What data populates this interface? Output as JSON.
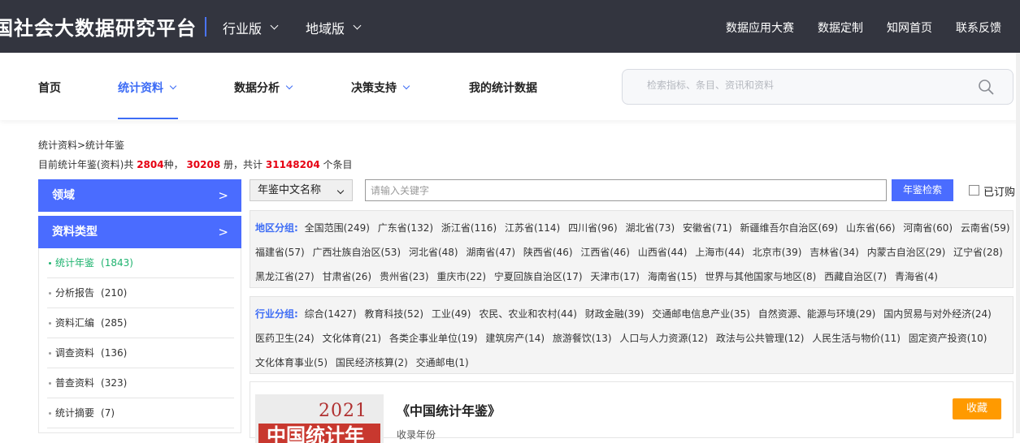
{
  "header": {
    "brand": "国社会大数据研究平台",
    "nav": [
      {
        "label": "行业版"
      },
      {
        "label": "地域版"
      }
    ],
    "links": [
      "数据应用大赛",
      "数据定制",
      "知网首页",
      "联系反馈"
    ]
  },
  "mainnav": {
    "items": [
      "首页",
      "统计资料",
      "数据分析",
      "决策支持",
      "我的统计数据"
    ],
    "active": "统计资料",
    "search_placeholder": "检索指标、条目、资讯和资料"
  },
  "breadcrumb": "统计资料>统计年鉴",
  "stats": {
    "prefix": "目前统计年鉴(资料)共",
    "kinds": "2804",
    "kinds_unit": "种，",
    "volumes": "30208",
    "volumes_unit": "册，共计",
    "entries": "31148204",
    "entries_unit": "个条目"
  },
  "sidebar": {
    "heads": [
      {
        "label": "领域",
        "arrow": ">"
      },
      {
        "label": "资料类型",
        "arrow": ">"
      }
    ],
    "items": [
      {
        "label": "统计年鉴",
        "count": "(1843)"
      },
      {
        "label": "分析报告",
        "count": "(210)"
      },
      {
        "label": "资料汇编",
        "count": "(285)"
      },
      {
        "label": "调查资料",
        "count": "(136)"
      },
      {
        "label": "普查资料",
        "count": "(323)"
      },
      {
        "label": "统计摘要",
        "count": "(7)"
      }
    ]
  },
  "filter": {
    "select_value": "年鉴中文名称",
    "keyword_placeholder": "请输入关键字",
    "search_button": "年鉴检索",
    "subscribed_label": "已订购"
  },
  "region_group": {
    "label": "地区分组:",
    "rows": [
      [
        "全国范围(249)",
        "广东省(132)",
        "浙江省(116)",
        "江苏省(114)",
        "四川省(96)",
        "湖北省(73)",
        "安徽省(71)",
        "新疆维吾尔自治区(69)",
        "山东省(66)",
        "河南省(60)",
        "云南省(59)"
      ],
      [
        "福建省(57)",
        "广西壮族自治区(53)",
        "河北省(48)",
        "湖南省(47)",
        "陕西省(46)",
        "江西省(46)",
        "山西省(44)",
        "上海市(44)",
        "北京市(39)",
        "吉林省(34)",
        "内蒙古自治区(29)",
        "辽宁省(28)"
      ],
      [
        "黑龙江省(27)",
        "甘肃省(26)",
        "贵州省(23)",
        "重庆市(22)",
        "宁夏回族自治区(17)",
        "天津市(17)",
        "海南省(15)",
        "世界与其他国家与地区(8)",
        "西藏自治区(7)",
        "青海省(4)"
      ]
    ]
  },
  "industry_group": {
    "label": "行业分组:",
    "rows": [
      [
        "综合(1427)",
        "教育科技(52)",
        "工业(49)",
        "农民、农业和农村(44)",
        "财政金融(39)",
        "交通邮电信息产业(35)",
        "自然资源、能源与环境(29)",
        "国内贸易与对外经济(24)"
      ],
      [
        "医药卫生(24)",
        "文化体育(21)",
        "各类企事业单位(19)",
        "建筑房产(14)",
        "旅游餐饮(13)",
        "人口与人力资源(12)",
        "政法与公共管理(12)",
        "人民生活与物价(11)",
        "固定资产投资(10)"
      ],
      [
        "文化体育事业(5)",
        "国民经济核算(2)",
        "交通邮电(1)"
      ]
    ]
  },
  "result": {
    "title": "《中国统计年鉴》",
    "subtitle": "收录年份",
    "cover_year": "2021",
    "cover_text": "中国统计年鉴",
    "fav_button": "收藏"
  },
  "colors": {
    "topbar": "#33353f",
    "accent": "#4a6cff",
    "highlight": "#e60012",
    "active_green": "#1fb36f",
    "fav_orange": "#ff9a00"
  }
}
